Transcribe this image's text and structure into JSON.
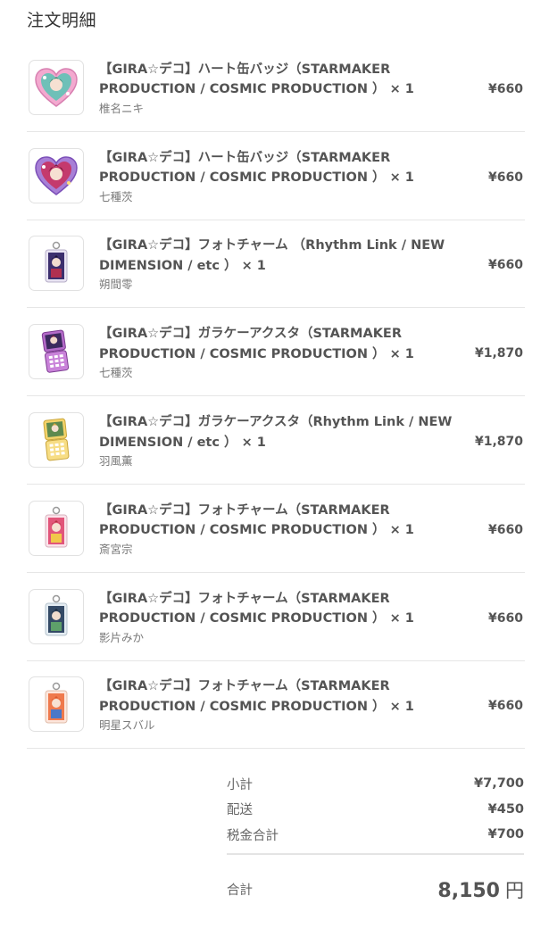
{
  "page": {
    "title": "注文明細"
  },
  "items": [
    {
      "name": "【GIRA☆デコ】ハート缶バッジ（STARMAKER PRODUCTION / COSMIC PRODUCTION ）",
      "qty": "× 1",
      "variant": "椎名ニキ",
      "price": "¥660",
      "thumb": "heart-badge-pink-icon"
    },
    {
      "name": "【GIRA☆デコ】ハート缶バッジ（STARMAKER PRODUCTION / COSMIC PRODUCTION ）",
      "qty": "× 1",
      "variant": "七種茨",
      "price": "¥660",
      "thumb": "heart-badge-purple-icon"
    },
    {
      "name": "【GIRA☆デコ】フォトチャーム （Rhythm Link / NEW DIMENSION / etc ）",
      "qty": "× 1",
      "variant": "朔間零",
      "price": "¥660",
      "thumb": "photo-charm-icon"
    },
    {
      "name": "【GIRA☆デコ】ガラケーアクスタ（STARMAKER PRODUCTION / COSMIC PRODUCTION ）",
      "qty": "× 1",
      "variant": "七種茨",
      "price": "¥1,870",
      "thumb": "flip-phone-purple-icon"
    },
    {
      "name": "【GIRA☆デコ】ガラケーアクスタ（Rhythm Link / NEW DIMENSION / etc ）",
      "qty": "× 1",
      "variant": "羽風薫",
      "price": "¥1,870",
      "thumb": "flip-phone-yellow-icon"
    },
    {
      "name": "【GIRA☆デコ】フォトチャーム（STARMAKER PRODUCTION / COSMIC PRODUCTION ）",
      "qty": "× 1",
      "variant": "斎宮宗",
      "price": "¥660",
      "thumb": "photo-charm-icon"
    },
    {
      "name": "【GIRA☆デコ】フォトチャーム（STARMAKER PRODUCTION / COSMIC PRODUCTION ）",
      "qty": "× 1",
      "variant": "影片みか",
      "price": "¥660",
      "thumb": "photo-charm-icon"
    },
    {
      "name": "【GIRA☆デコ】フォトチャーム（STARMAKER PRODUCTION / COSMIC PRODUCTION ）",
      "qty": "× 1",
      "variant": "明星スバル",
      "price": "¥660",
      "thumb": "photo-charm-icon"
    }
  ],
  "summary": {
    "subtotal_label": "小計",
    "subtotal_value": "¥7,700",
    "shipping_label": "配送",
    "shipping_value": "¥450",
    "tax_label": "税金合計",
    "tax_value": "¥700",
    "total_label": "合計",
    "total_amount": "8,150",
    "total_currency": "円"
  },
  "colors": {
    "text": "#545454",
    "muted": "#7a7a7a",
    "border": "#e6e6e6",
    "heart_pink": "#f3a9cf",
    "heart_purple": "#a77fd6",
    "phone_purple": "#b46bc9",
    "phone_yellow": "#f4d36a"
  }
}
